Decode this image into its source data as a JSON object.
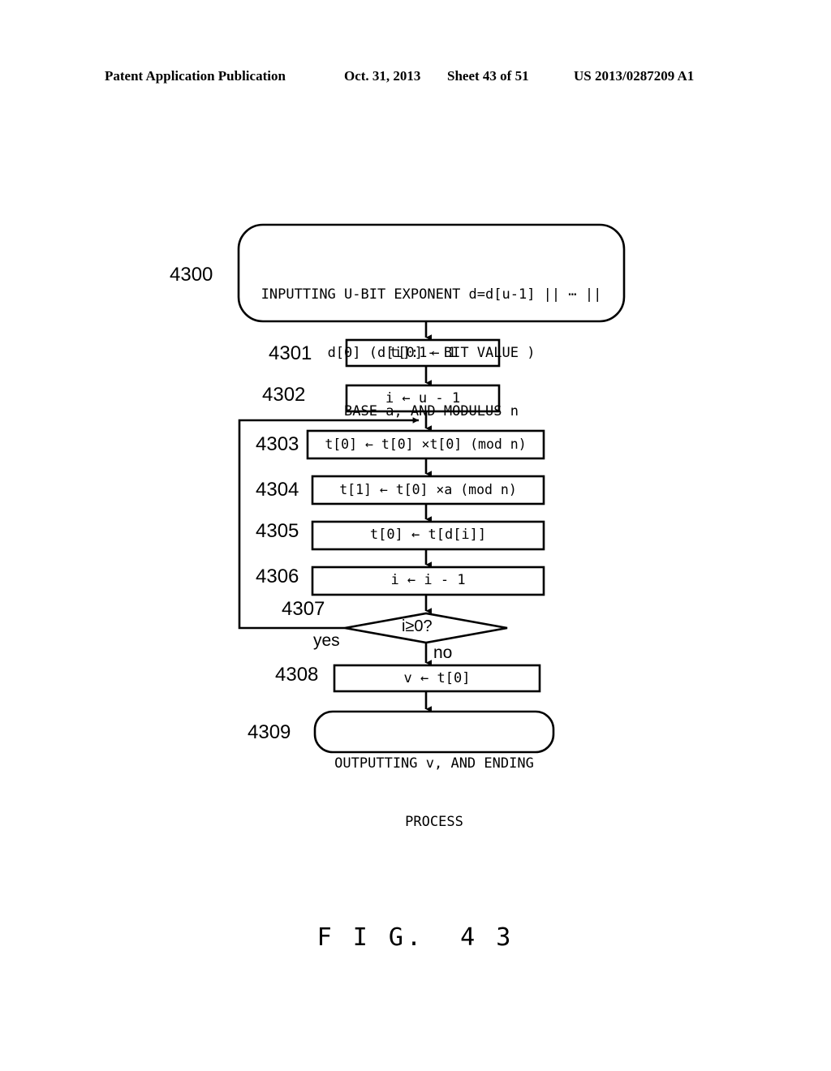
{
  "header": {
    "publication": "Patent Application Publication",
    "date": "Oct. 31, 2013",
    "sheet": "Sheet 43 of 51",
    "patent_number": "US 2013/0287209 A1"
  },
  "figure": {
    "caption": "F I G.  4 3",
    "ink_color": "#000000",
    "background_color": "#ffffff"
  },
  "flowchart": {
    "nodes": [
      {
        "ref": "4300",
        "shape": "terminator",
        "lines": [
          "INPUTTING U-BIT EXPONENT d=d[u-1] || ⋯ ||",
          "d[0] (d[i]:1- BIT VALUE )",
          "BASE a, AND MODULUS n"
        ]
      },
      {
        "ref": "4301",
        "shape": "process",
        "lines": [
          "t[0] ← 1"
        ]
      },
      {
        "ref": "4302",
        "shape": "process",
        "lines": [
          "i ← u - 1"
        ]
      },
      {
        "ref": "4303",
        "shape": "process",
        "lines": [
          "t[0] ← t[0] ×t[0] (mod n)"
        ]
      },
      {
        "ref": "4304",
        "shape": "process",
        "lines": [
          "t[1] ← t[0] ×a (mod n)"
        ]
      },
      {
        "ref": "4305",
        "shape": "process",
        "lines": [
          "t[0] ← t[d[i]]"
        ]
      },
      {
        "ref": "4306",
        "shape": "process",
        "lines": [
          "i ← i - 1"
        ]
      },
      {
        "ref": "4307",
        "shape": "decision",
        "lines": [
          "i≥0?"
        ]
      },
      {
        "ref": "4308",
        "shape": "process",
        "lines": [
          "v ← t[0]"
        ]
      },
      {
        "ref": "4309",
        "shape": "terminator",
        "lines": [
          "OUTPUTTING v, AND ENDING",
          "PROCESS"
        ]
      }
    ],
    "branch_labels": {
      "yes": "yes",
      "no": "no"
    }
  }
}
